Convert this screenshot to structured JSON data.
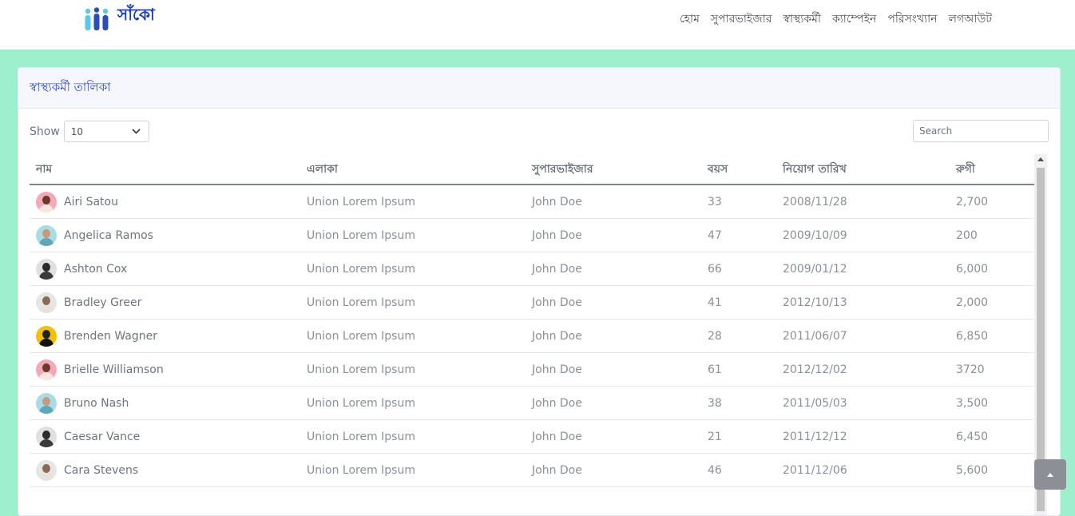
{
  "brand": {
    "name": "সাঁকো",
    "logo_icon": "people-logo-icon"
  },
  "nav": {
    "items": [
      {
        "label": "হোম"
      },
      {
        "label": "সুপারভাইজার"
      },
      {
        "label": "স্বাস্থ্যকর্মী"
      },
      {
        "label": "ক্যাম্পেইন"
      },
      {
        "label": "পরিসংখ্যান"
      },
      {
        "label": "লগআউট"
      }
    ]
  },
  "card": {
    "title": "স্বাস্থ্যকর্মী তালিকা"
  },
  "controls": {
    "show_label": "Show",
    "show_value": "10",
    "search_placeholder": "Search"
  },
  "table": {
    "headers": [
      "নাম",
      "এলাকা",
      "সুপারভাইজার",
      "বয়স",
      "নিয়োগ তারিখ",
      "রুগী"
    ],
    "rows": [
      {
        "name": "Airi Satou",
        "area": "Union Lorem Ipsum",
        "supervisor": "John Doe",
        "age": "33",
        "date": "2008/11/28",
        "patients": "2,700",
        "avatar": "woman-avatar"
      },
      {
        "name": "Angelica Ramos",
        "area": "Union Lorem Ipsum",
        "supervisor": "John Doe",
        "age": "47",
        "date": "2009/10/09",
        "patients": "200",
        "avatar": "woman-avatar"
      },
      {
        "name": "Ashton Cox",
        "area": "Union Lorem Ipsum",
        "supervisor": "John Doe",
        "age": "66",
        "date": "2009/01/12",
        "patients": "6,000",
        "avatar": "man-avatar"
      },
      {
        "name": "Bradley Greer",
        "area": "Union Lorem Ipsum",
        "supervisor": "John Doe",
        "age": "41",
        "date": "2012/10/13",
        "patients": "2,000",
        "avatar": "man-avatar"
      },
      {
        "name": "Brenden Wagner",
        "area": "Union Lorem Ipsum",
        "supervisor": "John Doe",
        "age": "28",
        "date": "2011/06/07",
        "patients": "6,850",
        "avatar": "man-avatar"
      },
      {
        "name": "Brielle Williamson",
        "area": "Union Lorem Ipsum",
        "supervisor": "John Doe",
        "age": "61",
        "date": "2012/12/02",
        "patients": "3720",
        "avatar": "woman-avatar"
      },
      {
        "name": "Bruno Nash",
        "area": "Union Lorem Ipsum",
        "supervisor": "John Doe",
        "age": "38",
        "date": "2011/05/03",
        "patients": "3,500",
        "avatar": "woman-avatar"
      },
      {
        "name": "Caesar Vance",
        "area": "Union Lorem Ipsum",
        "supervisor": "John Doe",
        "age": "21",
        "date": "2011/12/12",
        "patients": "6,450",
        "avatar": "man-avatar"
      },
      {
        "name": "Cara Stevens",
        "area": "Union Lorem Ipsum",
        "supervisor": "John Doe",
        "age": "46",
        "date": "2011/12/06",
        "patients": "5,600",
        "avatar": "man-avatar"
      }
    ]
  },
  "colors": {
    "page_bg": "#9eefcd",
    "brand": "#1a3bb5",
    "title": "#2d4fc4",
    "avatar_bgs": [
      "#f4a9b8",
      "#a8dde8",
      "#e0e0e0",
      "#e6e6e6",
      "#f2c200",
      "#f4a9b8",
      "#a8dde8",
      "#e0e0e0",
      "#e6e6e6"
    ],
    "avatar_heads": [
      "#6b3a2a",
      "#c89a7a",
      "#2b2b2b",
      "#8a6a55",
      "#222222",
      "#6b3a2a",
      "#c89a7a",
      "#2b2b2b",
      "#8a6a55"
    ],
    "avatar_bodies": [
      "#f7e7e0",
      "#5fa8b8",
      "#3a3a3a",
      "#e9e2dc",
      "#111111",
      "#f7e7e0",
      "#5fa8b8",
      "#3a3a3a",
      "#e9e2dc"
    ]
  }
}
